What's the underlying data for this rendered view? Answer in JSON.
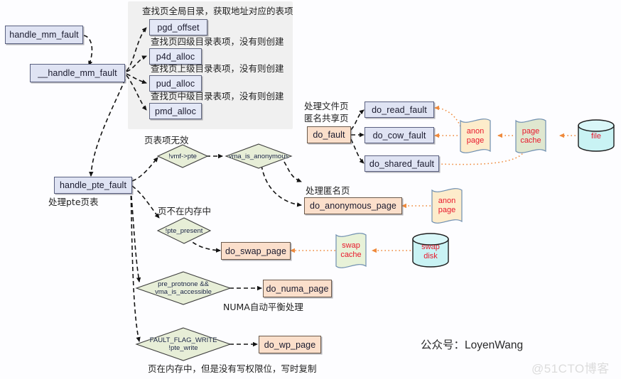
{
  "diagram": {
    "title": "Linux page fault handling flow",
    "brand": "公众号：LoyenWang",
    "watermark": "@51CTO博客",
    "colors": {
      "box_blue_fill": "#dfe3f3",
      "box_orange_fill": "#fbdfcb",
      "diamond_fill": "#e7eed7",
      "anon_page_fill": "#fdeccb",
      "page_cache_fill": "#dfe7cf",
      "file_fill": "#c9f3f4",
      "swap_cache_fill": "#e8f2d8",
      "swap_disk_fill": "#c9f3f4",
      "panel_fill": "#f0f0f0",
      "wave_text": "#e8192c",
      "dotted_arrow": "#ef8a3c",
      "dashed_arrow": "#1a1a1a"
    },
    "panel": {
      "name": "page-table-walk-panel"
    },
    "nodes": {
      "handle_mm_fault": "handle_mm_fault",
      "__handle_mm_fault": "__handle_mm_fault",
      "pgd_offset": "pgd_offset",
      "p4d_alloc": "p4d_alloc",
      "pud_alloc": "pud_alloc",
      "pmd_alloc": "pmd_alloc",
      "handle_pte_fault": "handle_pte_fault",
      "do_fault": "do_fault",
      "do_read_fault": "do_read_fault",
      "do_cow_fault": "do_cow_fault",
      "do_shared_fault": "do_shared_fault",
      "do_anonymous_page": "do_anonymous_page",
      "do_swap_page": "do_swap_page",
      "do_numa_page": "do_numa_page",
      "do_wp_page": "do_wp_page"
    },
    "decisions": {
      "vmf_pte": {
        "line1": "!vmf->pte",
        "line2": ""
      },
      "vma_is_anon": {
        "line1": "vma_is_anonymous",
        "line2": ""
      },
      "pte_present": {
        "line1": "!pte_present",
        "line2": ""
      },
      "numa": {
        "line1": "pre_protnone &&",
        "line2": "vma_is_accessible"
      },
      "wp": {
        "line1": "FAULT_FLAG_WRITE",
        "line2": "!pte_write"
      }
    },
    "stores": {
      "anon_page_top": {
        "line1": "anon",
        "line2": "page"
      },
      "page_cache": {
        "line1": "page",
        "line2": "cache"
      },
      "file": {
        "line1": "file",
        "line2": ""
      },
      "anon_page_bottom": {
        "line1": "anon",
        "line2": "page"
      },
      "swap_cache": {
        "line1": "swap",
        "line2": "cache"
      },
      "swap_disk": {
        "line1": "swap",
        "line2": "disk"
      }
    },
    "annotations": {
      "pgd_note": "查找页全局目录，获取地址对应的表项",
      "p4d_note": "查找页四级目录表项，没有则创建",
      "pud_note": "查找页上级目录表项，没有则创建",
      "pmd_note": "查找页中级目录表项，没有则创建",
      "pte_invalid": "页表项无效",
      "handle_pte_note": "处理pte页表",
      "do_fault_note_1": "处理文件页",
      "do_fault_note_2": "匿名共享页",
      "do_anon_note": "处理匿名页",
      "not_in_mem": "页不在内存中",
      "numa_note": "NUMA自动平衡处理",
      "wp_note": "页在内存中，但是没有写权限位，写时复制"
    }
  }
}
